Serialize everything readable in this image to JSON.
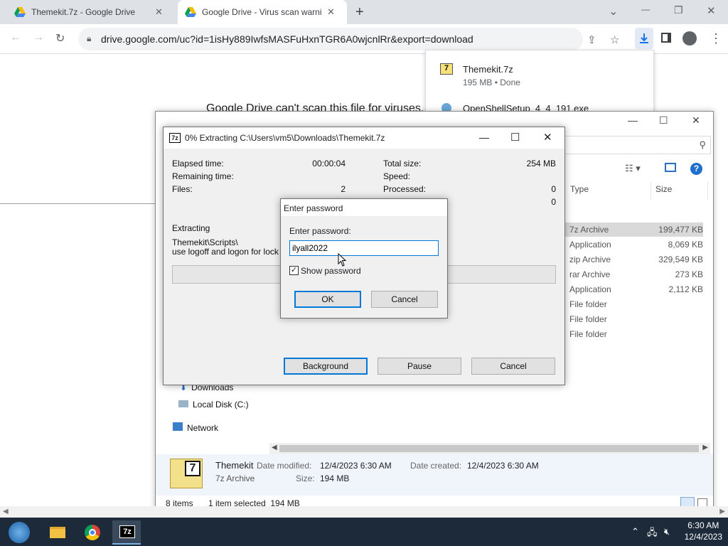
{
  "browser": {
    "tabs": [
      {
        "title": "Themekit.7z - Google Drive",
        "close": "✕"
      },
      {
        "title": "Google Drive - Virus scan warni",
        "close": "✕"
      }
    ],
    "new_tab": "+",
    "window_controls": {
      "dropdown": "⌄",
      "minimize": "—",
      "restore": "❐",
      "close": "✕"
    },
    "url": "drive.google.com/uc?id=1isHy889IwfsMASFuHxnTGR6A0wjcnlRr&export=download"
  },
  "page": {
    "message": "Google Drive can't scan this file for viruses."
  },
  "downloads": [
    {
      "name": "Themekit.7z",
      "status": "195 MB • Done"
    },
    {
      "name": "OpenShellSetup_4_4_191.exe",
      "status": ""
    }
  ],
  "explorer": {
    "columns": {
      "type": "Type",
      "size": "Size"
    },
    "files": [
      {
        "type": "7z Archive",
        "size": "199,477 KB",
        "selected": true
      },
      {
        "type": "Application",
        "size": "8,069 KB"
      },
      {
        "type": "zip Archive",
        "size": "329,549 KB"
      },
      {
        "type": "rar Archive",
        "size": "273 KB"
      },
      {
        "type": "Application",
        "size": "2,112 KB"
      },
      {
        "type": "File folder",
        "size": ""
      },
      {
        "type": "File folder",
        "size": ""
      },
      {
        "type": "File folder",
        "size": ""
      }
    ],
    "nav": {
      "downloads": "Downloads",
      "local_disk": "Local Disk (C:)",
      "network": "Network"
    },
    "details": {
      "name": "Themekit",
      "kind": "7z Archive",
      "date_modified_label": "Date modified:",
      "date_modified": "12/4/2023 6:30 AM",
      "size_label": "Size:",
      "size": "194 MB",
      "date_created_label": "Date created:",
      "date_created": "12/4/2023 6:30 AM"
    },
    "status": {
      "items": "8 items",
      "selected": "1 item selected  194 MB"
    }
  },
  "progress": {
    "title": "0% Extracting C:\\Users\\vm5\\Downloads\\Themekit.7z",
    "elapsed_label": "Elapsed time:",
    "elapsed": "00:00:04",
    "remaining_label": "Remaining time:",
    "files_label": "Files:",
    "files": "2",
    "total_label": "Total size:",
    "total": "254 MB",
    "speed_label": "Speed:",
    "processed_label": "Processed:",
    "processed": "0",
    "extra": "0",
    "extracting": "Extracting",
    "path1": "Themekit\\Scripts\\",
    "path2": "use logoff and logon for lock and",
    "background": "Background",
    "pause": "Pause",
    "cancel": "Cancel",
    "percent": 0
  },
  "password": {
    "title": "Enter password",
    "label": "Enter password:",
    "value": "ilyall2022",
    "show_label": "Show password",
    "show_checked": true,
    "ok": "OK",
    "cancel": "Cancel"
  },
  "taskbar": {
    "time": "6:30 AM",
    "date": "12/4/2023"
  }
}
